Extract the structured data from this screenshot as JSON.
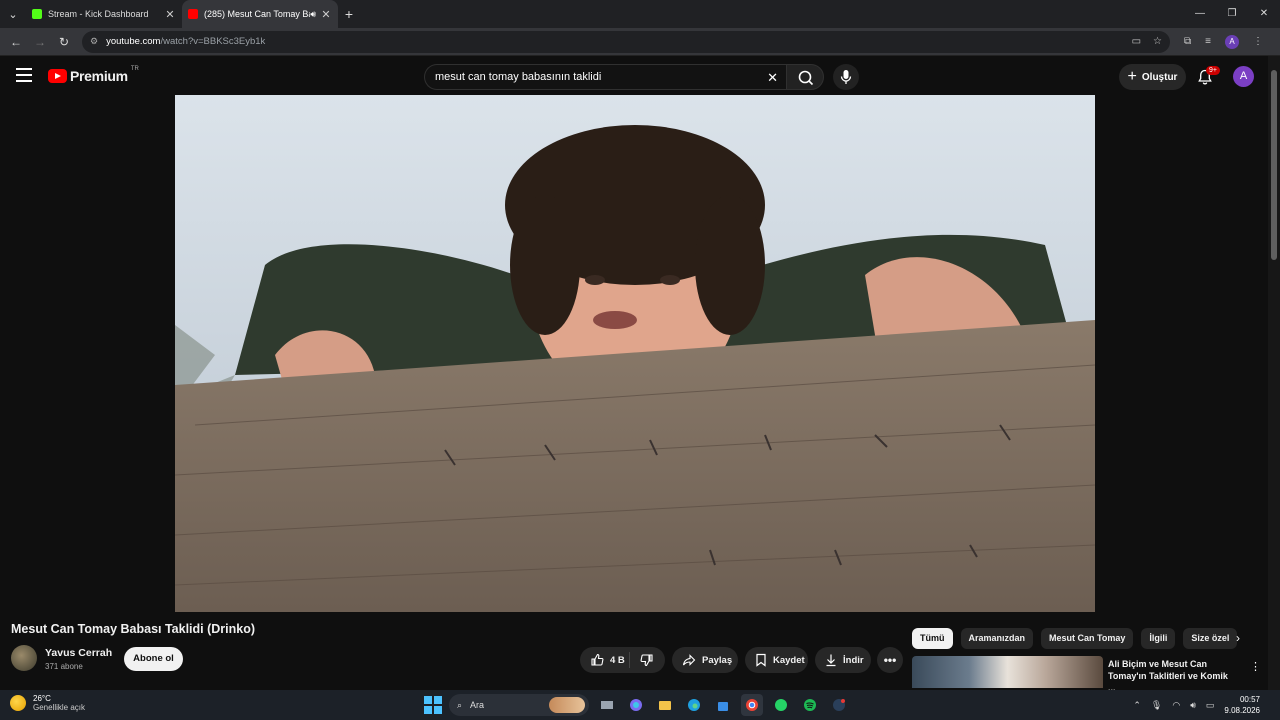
{
  "browser": {
    "tabs": [
      {
        "title": "Stream - Kick Dashboard",
        "favicon_color": "#53fc18",
        "active": false
      },
      {
        "title": "(285) Mesut Can Tomay Bab",
        "favicon_color": "#ff0000",
        "active": true
      }
    ],
    "address": {
      "host": "youtube.com",
      "path": "/watch?v=BBKSc3Eyb1k"
    },
    "profile_initial": "A"
  },
  "masthead": {
    "logo_text": "Premium",
    "country_code": "TR",
    "search_value": "mesut can tomay babasının taklidi",
    "create_label": "Oluştur",
    "notification_badge": "9+",
    "avatar_initial": "A"
  },
  "video": {
    "title": "Mesut Can Tomay Babası Taklidi (Drinko)",
    "channel": {
      "name": "Yavus Cerrah",
      "subscribers": "371 abone"
    },
    "subscribe_label": "Abone ol",
    "like_count": "4 B",
    "share_label": "Paylaş",
    "save_label": "Kaydet",
    "download_label": "İndir"
  },
  "chips": [
    "Tümü",
    "Aramanızdan",
    "Mesut Can Tomay",
    "İlgili",
    "Size özel"
  ],
  "related": {
    "title": "Ali Biçim ve Mesut Can Tomay'ın Taklitleri ve Komik ..."
  },
  "taskbar": {
    "weather": {
      "temp": "26°C",
      "desc": "Genellikle açık"
    },
    "search_placeholder": "Ara",
    "time": "00:57",
    "date": "9.08.2026"
  }
}
